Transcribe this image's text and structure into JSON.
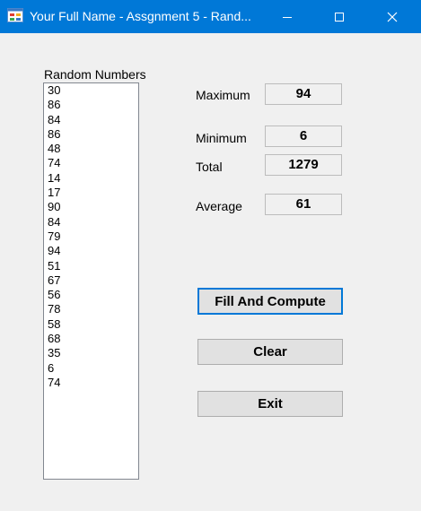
{
  "window": {
    "title": "Your Full Name - Assgnment 5 - Rand...",
    "titlebar_color": "#0078d7"
  },
  "list": {
    "label": "Random Numbers",
    "items": [
      "30",
      "86",
      "84",
      "86",
      "48",
      "74",
      "14",
      "17",
      "90",
      "84",
      "79",
      "94",
      "51",
      "67",
      "56",
      "78",
      "58",
      "68",
      "35",
      "6",
      "74"
    ]
  },
  "stats": {
    "maximum_label": "Maximum",
    "maximum_value": "94",
    "minimum_label": "Minimum",
    "minimum_value": "6",
    "total_label": "Total",
    "total_value": "1279",
    "average_label": "Average",
    "average_value": "61"
  },
  "buttons": {
    "fill_label": "Fill And Compute",
    "clear_label": "Clear",
    "exit_label": "Exit"
  },
  "icons": {
    "app": "app-window-icon",
    "minimize": "minimize-icon",
    "maximize": "maximize-icon",
    "close": "close-icon"
  }
}
